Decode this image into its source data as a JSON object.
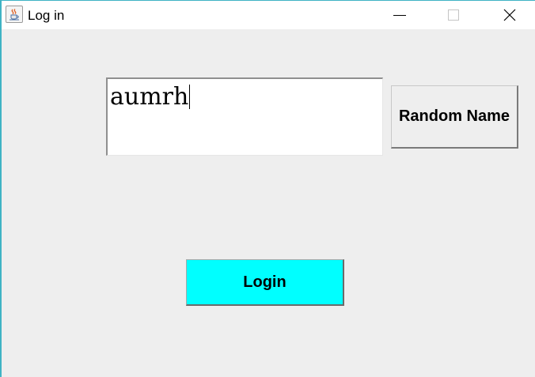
{
  "window": {
    "title": "Log in",
    "icon": "java-coffee-cup-icon",
    "controls": {
      "minimize_icon": "minimize-icon",
      "maximize_icon": "maximize-icon",
      "close_icon": "close-icon"
    }
  },
  "form": {
    "name_value": "aumrh",
    "random_name_label": "Random Name",
    "login_label": "Login"
  },
  "colors": {
    "window_background": "#eeeeee",
    "titlebar_background": "#ffffff",
    "login_button_background": "#00ffff",
    "window_border_accent": "#3fb3c4"
  }
}
